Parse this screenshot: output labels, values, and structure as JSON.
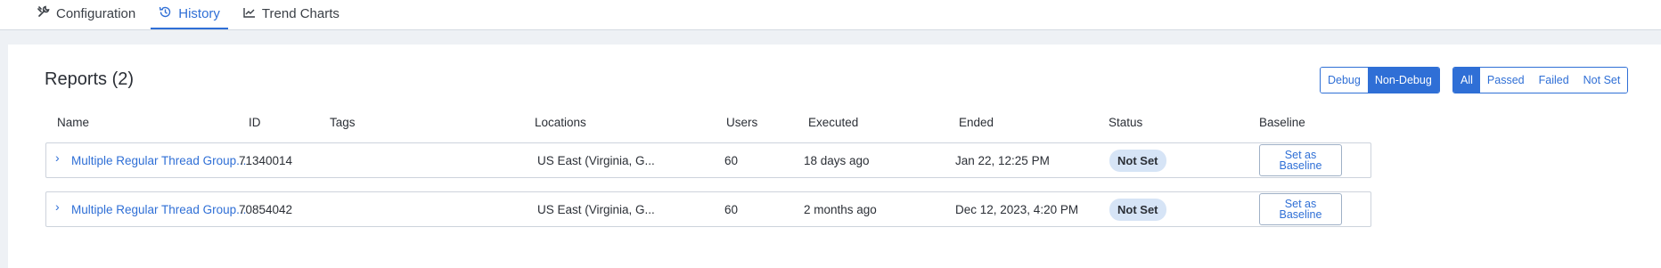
{
  "tabs": [
    {
      "label": "Configuration",
      "icon": "wrench-icon"
    },
    {
      "label": "History",
      "icon": "history-icon"
    },
    {
      "label": "Trend Charts",
      "icon": "trend-chart-icon"
    }
  ],
  "active_tab": "History",
  "reports": {
    "title": "Reports (2)",
    "mode_filter": {
      "options": [
        "Debug",
        "Non-Debug"
      ],
      "selected": "Non-Debug"
    },
    "status_filter": {
      "options": [
        "All",
        "Passed",
        "Failed",
        "Not Set"
      ],
      "selected": "All"
    },
    "columns": [
      "Name",
      "ID",
      "Tags",
      "Locations",
      "Users",
      "Executed",
      "Ended",
      "Status",
      "Baseline"
    ],
    "rows": [
      {
        "name": "Multiple Regular Thread Group...",
        "id": "71340014",
        "tags": "",
        "location": "US East (Virginia, G...",
        "users": "60",
        "executed": "18 days ago",
        "ended": "Jan 22, 12:25 PM",
        "status": "Not Set",
        "baseline_button": "Set as Baseline"
      },
      {
        "name": "Multiple Regular Thread Group...",
        "id": "70854042",
        "tags": "",
        "location": "US East (Virginia, G...",
        "users": "60",
        "executed": "2 months ago",
        "ended": "Dec 12, 2023, 4:20 PM",
        "status": "Not Set",
        "baseline_button": "Set as Baseline"
      }
    ]
  },
  "colors": {
    "accent": "#2f6fd6",
    "badge_bg": "#d6e4f6",
    "page_bg": "#eef1f5"
  }
}
